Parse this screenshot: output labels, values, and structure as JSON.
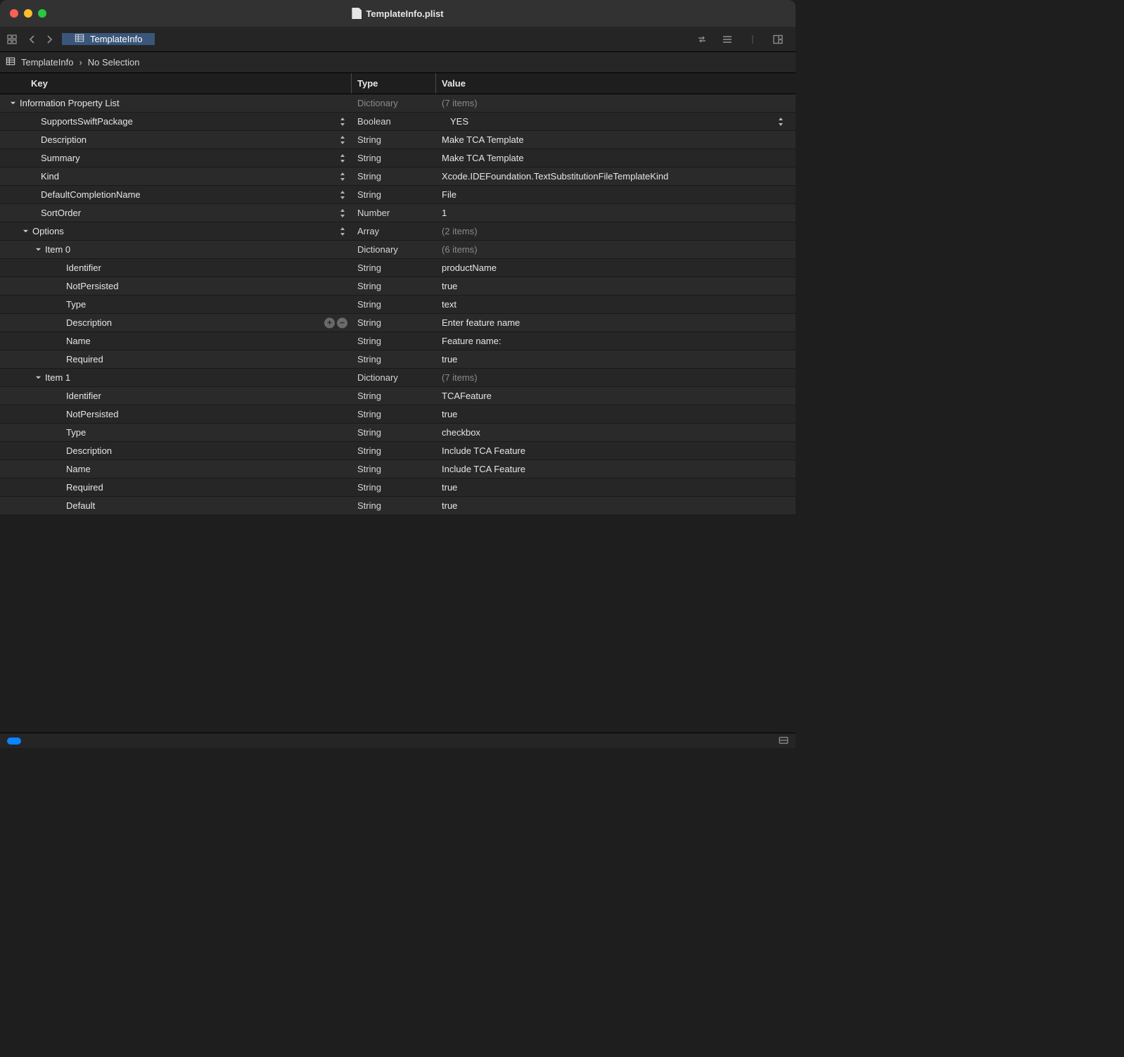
{
  "window": {
    "title": "TemplateInfo.plist"
  },
  "tab": {
    "label": "TemplateInfo"
  },
  "breadcrumb": {
    "root": "TemplateInfo",
    "selection": "No Selection"
  },
  "columns": {
    "key": "Key",
    "type": "Type",
    "value": "Value"
  },
  "rows": [
    {
      "indent": 0,
      "expand": "down",
      "key": "Information Property List",
      "type": "Dictionary",
      "typeDim": true,
      "value": "(7 items)",
      "valueDim": true
    },
    {
      "indent": 1,
      "key": "SupportsSwiftPackage",
      "stepper": true,
      "type": "Boolean",
      "value": "YES",
      "valueIndent": true,
      "valueStepper": true
    },
    {
      "indent": 1,
      "key": "Description",
      "stepper": true,
      "type": "String",
      "value": "Make TCA Template"
    },
    {
      "indent": 1,
      "key": "Summary",
      "stepper": true,
      "type": "String",
      "value": "Make TCA Template"
    },
    {
      "indent": 1,
      "key": "Kind",
      "stepper": true,
      "type": "String",
      "value": "Xcode.IDEFoundation.TextSubstitutionFileTemplateKind"
    },
    {
      "indent": 1,
      "key": "DefaultCompletionName",
      "stepper": true,
      "type": "String",
      "value": "File"
    },
    {
      "indent": 1,
      "key": "SortOrder",
      "stepper": true,
      "type": "Number",
      "value": "1"
    },
    {
      "indent": 1,
      "expand": "down",
      "key": "Options",
      "stepper": true,
      "type": "Array",
      "value": "(2 items)",
      "valueDim": true
    },
    {
      "indent": 2,
      "expand": "down",
      "key": "Item 0",
      "type": "Dictionary",
      "value": "(6 items)",
      "valueDim": true
    },
    {
      "indent": 3,
      "key": "Identifier",
      "type": "String",
      "value": "productName"
    },
    {
      "indent": 3,
      "key": "NotPersisted",
      "type": "String",
      "value": "true"
    },
    {
      "indent": 3,
      "key": "Type",
      "type": "String",
      "value": "text"
    },
    {
      "indent": 3,
      "key": "Description",
      "type": "String",
      "value": "Enter feature name",
      "plusMinus": true
    },
    {
      "indent": 3,
      "key": "Name",
      "type": "String",
      "value": "Feature name:"
    },
    {
      "indent": 3,
      "key": "Required",
      "type": "String",
      "value": "true"
    },
    {
      "indent": 2,
      "expand": "down",
      "key": "Item 1",
      "type": "Dictionary",
      "value": "(7 items)",
      "valueDim": true
    },
    {
      "indent": 3,
      "key": "Identifier",
      "type": "String",
      "value": "TCAFeature"
    },
    {
      "indent": 3,
      "key": "NotPersisted",
      "type": "String",
      "value": "true"
    },
    {
      "indent": 3,
      "key": "Type",
      "type": "String",
      "value": "checkbox"
    },
    {
      "indent": 3,
      "key": "Description",
      "type": "String",
      "value": "Include TCA Feature"
    },
    {
      "indent": 3,
      "key": "Name",
      "type": "String",
      "value": "Include TCA Feature"
    },
    {
      "indent": 3,
      "key": "Required",
      "type": "String",
      "value": "true"
    },
    {
      "indent": 3,
      "key": "Default",
      "type": "String",
      "value": "true"
    }
  ]
}
